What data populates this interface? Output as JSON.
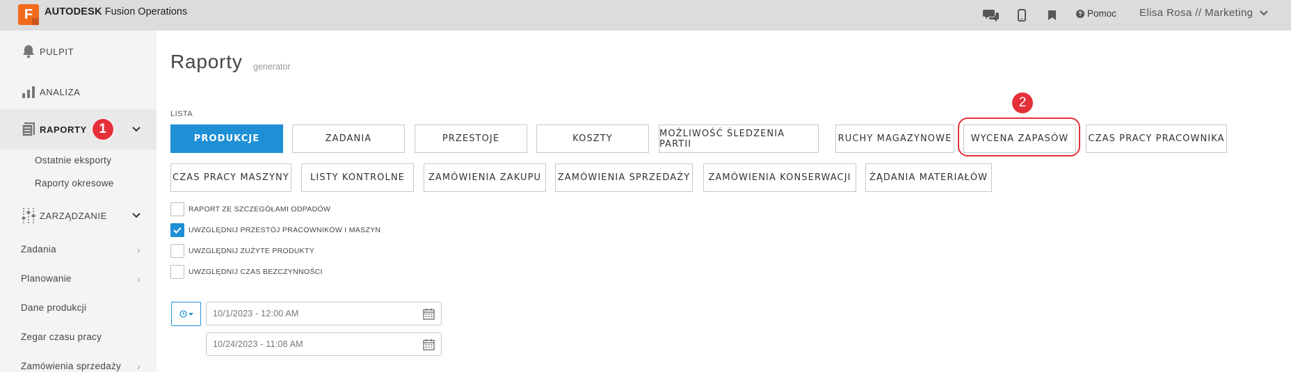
{
  "header": {
    "logo_letter": "F",
    "brand_bold": "AUTODESK",
    "brand_rest": "Fusion Operations",
    "help_label": "Pomoc",
    "user_label": "Elisa Rosa // Marketing",
    "icons": [
      "chat-icon",
      "mobile-icon",
      "bookmark-icon",
      "help-icon",
      "chevron-down-icon"
    ]
  },
  "sidebar": {
    "items": [
      {
        "label": "PULPIT",
        "icon": "bell-icon"
      },
      {
        "label": "ANALIZA",
        "icon": "bar-chart-icon"
      },
      {
        "label": "RAPORTY",
        "icon": "report-icon",
        "active": true,
        "badge": "1"
      },
      {
        "label": "ZARZĄDZANIE",
        "icon": "sliders-icon"
      }
    ],
    "raporty_sub": [
      "Ostatnie eksporty",
      "Raporty okresowe"
    ],
    "management_items": [
      {
        "label": "Zadania",
        "has_arrow": true
      },
      {
        "label": "Planowanie",
        "has_arrow": true
      },
      {
        "label": "Dane produkcji",
        "has_arrow": false
      },
      {
        "label": "Zegar czasu pracy",
        "has_arrow": false
      },
      {
        "label": "Zamówienia sprzedaży",
        "has_arrow": true
      }
    ]
  },
  "main": {
    "title": "Raporty",
    "subtitle": "generator",
    "list_label": "LISTA",
    "report_buttons_row1": [
      "PRODUKCJE",
      "ZADANIA",
      "PRZESTOJE",
      "KOSZTY",
      "MOŻLIWOŚĆ ŚLEDZENIA PARTII",
      "RUCHY MAGAZYNOWE",
      "WYCENA ZAPASÓW",
      "CZAS PRACY PRACOWNIKA"
    ],
    "report_buttons_row2": [
      "CZAS PRACY MASZYNY",
      "LISTY KONTROLNE",
      "ZAMÓWIENIA ZAKUPU",
      "ZAMÓWIENIA SPRZEDAŻY",
      "ZAMÓWIENIA KONSERWACJI",
      "ŻĄDANIA MATERIAŁÓW"
    ],
    "selected_report": "PRODUKCJE",
    "highlight_badge": "2",
    "options": [
      {
        "label": "RAPORT ZE SZCZEGÓŁAMI ODPADÓW",
        "checked": false
      },
      {
        "label": "UWZGLĘDNIJ PRZESTÓJ PRACOWNIKÓW I MASZYN",
        "checked": true
      },
      {
        "label": "UWZGLĘDNIJ ZUŻYTE PRODUKTY",
        "checked": false
      },
      {
        "label": "UWZGLĘDNIJ CZAS BEZCZYNNOŚCI",
        "checked": false
      }
    ],
    "date_from": "10/1/2023 - 12:00 AM",
    "date_to": "10/24/2023 - 11:08 AM"
  },
  "colors": {
    "primary": "#1f8fd6",
    "brand_orange": "#f26b1d",
    "annotation_red": "#e5303a"
  }
}
